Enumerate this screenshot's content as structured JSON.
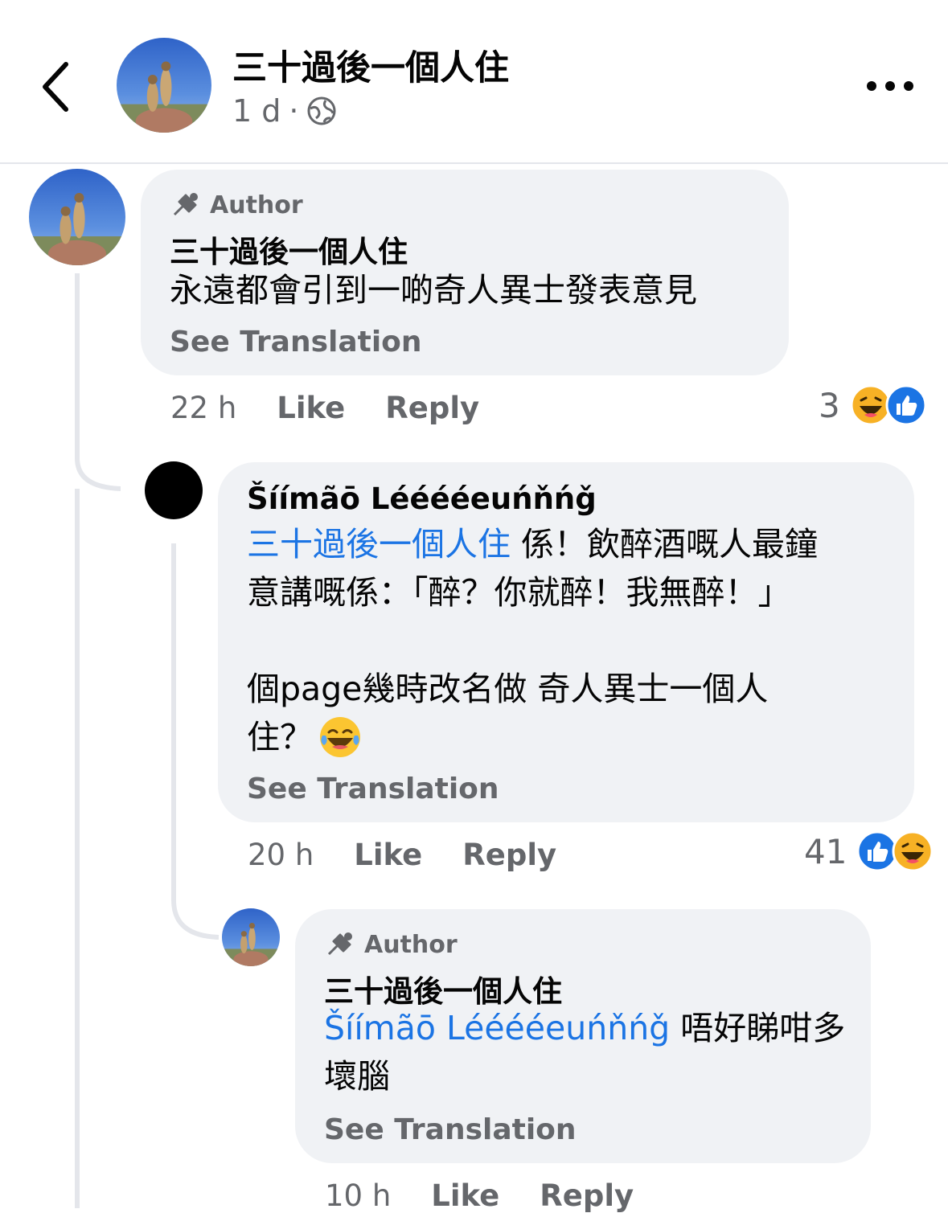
{
  "header": {
    "title": "三十過後一個人住",
    "time": "1 d",
    "separator": "·",
    "privacy_icon": "globe-icon",
    "back_icon": "chevron-left-icon",
    "more_icon": "more-horizontal-icon"
  },
  "comments": [
    {
      "badge": "Author",
      "badge_icon": "megaphone-icon",
      "name": "三十過後一個人住",
      "text": "永遠都會引到一啲奇人異士發表意見",
      "see_translation": "See Translation",
      "time": "22 h",
      "like": "Like",
      "reply": "Reply",
      "reaction_count": "3",
      "reaction_icons": [
        "haha-icon",
        "like-icon"
      ]
    },
    {
      "name": "Šíímãō Lééééeuńňńǧ",
      "mention": "三十過後一個人住",
      "text_line1": " 係！飲醉酒嘅人最鐘",
      "text_line2": "意講嘅係：「醉？你就醉！我無醉！」",
      "text_line3": "個page幾時改名做 奇人異士一個人",
      "text_line4": "住？ ",
      "emoji_icon": "laugh-tears-emoji",
      "see_translation": "See Translation",
      "time": "20 h",
      "like": "Like",
      "reply": "Reply",
      "reaction_count": "41",
      "reaction_icons": [
        "like-icon",
        "haha-icon"
      ]
    },
    {
      "badge": "Author",
      "badge_icon": "megaphone-icon",
      "name": "三十過後一個人住",
      "mention": "Šíímãō Lééééeuńňńǧ",
      "text_line1": " 唔好睇咁多",
      "text_line2": "壞腦",
      "see_translation": "See Translation",
      "time": "10 h",
      "like": "Like",
      "reply": "Reply"
    }
  ],
  "colors": {
    "bubble": "#f0f2f5",
    "mention": "#1b74e4",
    "secondary_text": "#65676b",
    "like_blue": "#1b74e4"
  }
}
